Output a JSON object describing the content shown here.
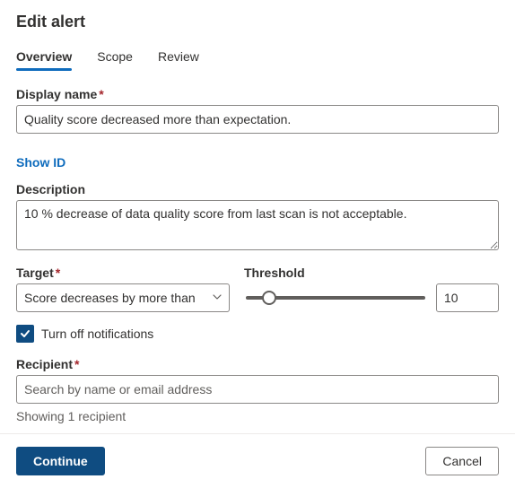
{
  "title": "Edit alert",
  "tabs": {
    "overview": "Overview",
    "scope": "Scope",
    "review": "Review"
  },
  "displayName": {
    "label": "Display name",
    "value": "Quality score decreased more than expectation."
  },
  "showIdLink": "Show ID",
  "description": {
    "label": "Description",
    "value": "10 % decrease of data quality score from last scan is not acceptable."
  },
  "target": {
    "label": "Target",
    "selected": "Score decreases by more than"
  },
  "threshold": {
    "label": "Threshold",
    "value": "10",
    "min": "0",
    "max": "100"
  },
  "notifications": {
    "label": "Turn off notifications",
    "checked": true
  },
  "recipient": {
    "label": "Recipient",
    "placeholder": "Search by name or email address",
    "hint": "Showing 1 recipient"
  },
  "footer": {
    "continue": "Continue",
    "cancel": "Cancel"
  }
}
